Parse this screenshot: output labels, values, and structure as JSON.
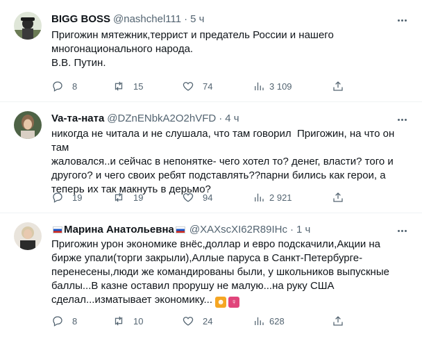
{
  "tweets": [
    {
      "name": "BIGG BOSS",
      "handle": "@nashchel111",
      "dot": "·",
      "time": "5 ч",
      "text": "Пригожин мятежник,террист и предатель России и нашего\nмногонационального народа.\nВ.В. Путин.",
      "replies": "8",
      "retweets": "15",
      "likes": "74",
      "views": "3 109",
      "avatar_color": "#3f4a35"
    },
    {
      "name": "Va-та-ната",
      "handle": "@DZnENbkA2O2hVFD",
      "dot": "·",
      "time": "4 ч",
      "text": "никогда не читала и не слушала, что там говорил  Пригожин, на что он там\nжаловался..и сейчас в непонятке- чего хотел то? денег, власти? того и\nдругого? и чего своих ребят подставлять??парни бились как герои, а\nтеперь их так макнуть в дерьмо?",
      "replies": "19",
      "retweets": "19",
      "likes": "94",
      "views": "2 921",
      "avatar_color": "#5a6e4a"
    },
    {
      "name": "Марина Анатольевна",
      "handle": "@XAXscXI62R89IHc",
      "dot": "·",
      "time": "1 ч",
      "text": "Пригожин урон экономике внёс,доллар и евро подскачили,Акции на\nбирже упали(торги закрыли),Аллые паруса в Санкт-Петербурге-\nперенесены,люди же командированы были, у школьников выпускные\nбаллы...В казне оставил прорушу не малую...на руку США\nсделал...изматывает экономику...",
      "replies": "8",
      "retweets": "10",
      "likes": "24",
      "views": "628",
      "avatar_color": "#c9b7a4"
    }
  ],
  "icons": {
    "reply": "reply-icon",
    "retweet": "retweet-icon",
    "like": "heart-icon",
    "views": "views-chart-icon",
    "share": "share-icon",
    "more": "more-icon"
  },
  "colors": {
    "text": "#0f1419",
    "secondary": "#536471",
    "divider": "#eff3f4"
  }
}
